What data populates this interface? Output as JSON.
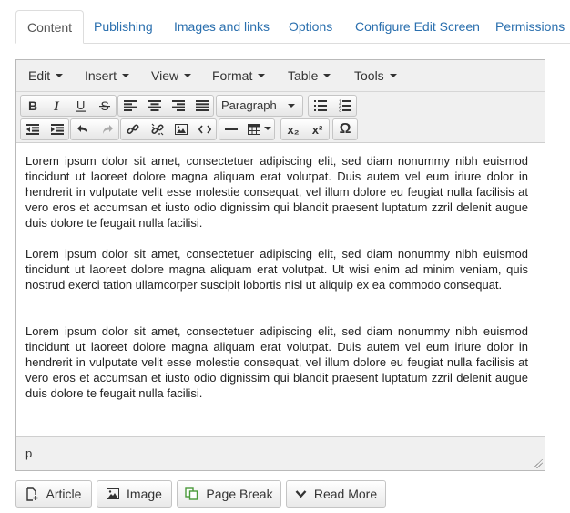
{
  "tabs": [
    "Content",
    "Publishing",
    "Images and links",
    "Options",
    "Configure Edit Screen",
    "Permissions"
  ],
  "menubar": [
    "Edit",
    "Insert",
    "View",
    "Format",
    "Table",
    "Tools"
  ],
  "toolbar": {
    "format_select": "Paragraph",
    "subscript_label": "x₂",
    "superscript_label": "x²",
    "omega_label": "Ω"
  },
  "content": {
    "paragraphs": [
      "Lorem ipsum dolor sit amet, consectetuer adipiscing elit, sed diam nonummy nibh euismod tincidunt ut laoreet dolore magna aliquam erat volutpat. Duis autem vel eum iriure dolor in hendrerit in vulputate velit esse molestie consequat, vel illum dolore eu feugiat nulla facilisis at vero eros et accumsan et iusto odio dignissim qui blandit praesent luptatum zzril delenit augue duis dolore te feugait nulla facilisi.",
      "Lorem ipsum dolor sit amet, consectetuer adipiscing elit, sed diam nonummy nibh euismod tincidunt ut laoreet dolore magna aliquam erat volutpat. Ut wisi enim ad minim veniam, quis nostrud exerci tation ullamcorper suscipit lobortis nisl ut aliquip ex ea commodo consequat.",
      "Lorem ipsum dolor sit amet, consectetuer adipiscing elit, sed diam nonummy nibh euismod tincidunt ut laoreet dolore magna aliquam erat volutpat. Duis autem vel eum iriure dolor in hendrerit in vulputate velit esse molestie consequat, vel illum dolore eu feugiat nulla facilisis at vero eros et accumsan et iusto odio dignissim qui blandit praesent luptatum zzril delenit augue duis dolore te feugait nulla facilisi."
    ]
  },
  "statusbar": {
    "path": "p"
  },
  "buttons": {
    "article": "Article",
    "image": "Image",
    "page_break": "Page Break",
    "read_more": "Read More"
  }
}
